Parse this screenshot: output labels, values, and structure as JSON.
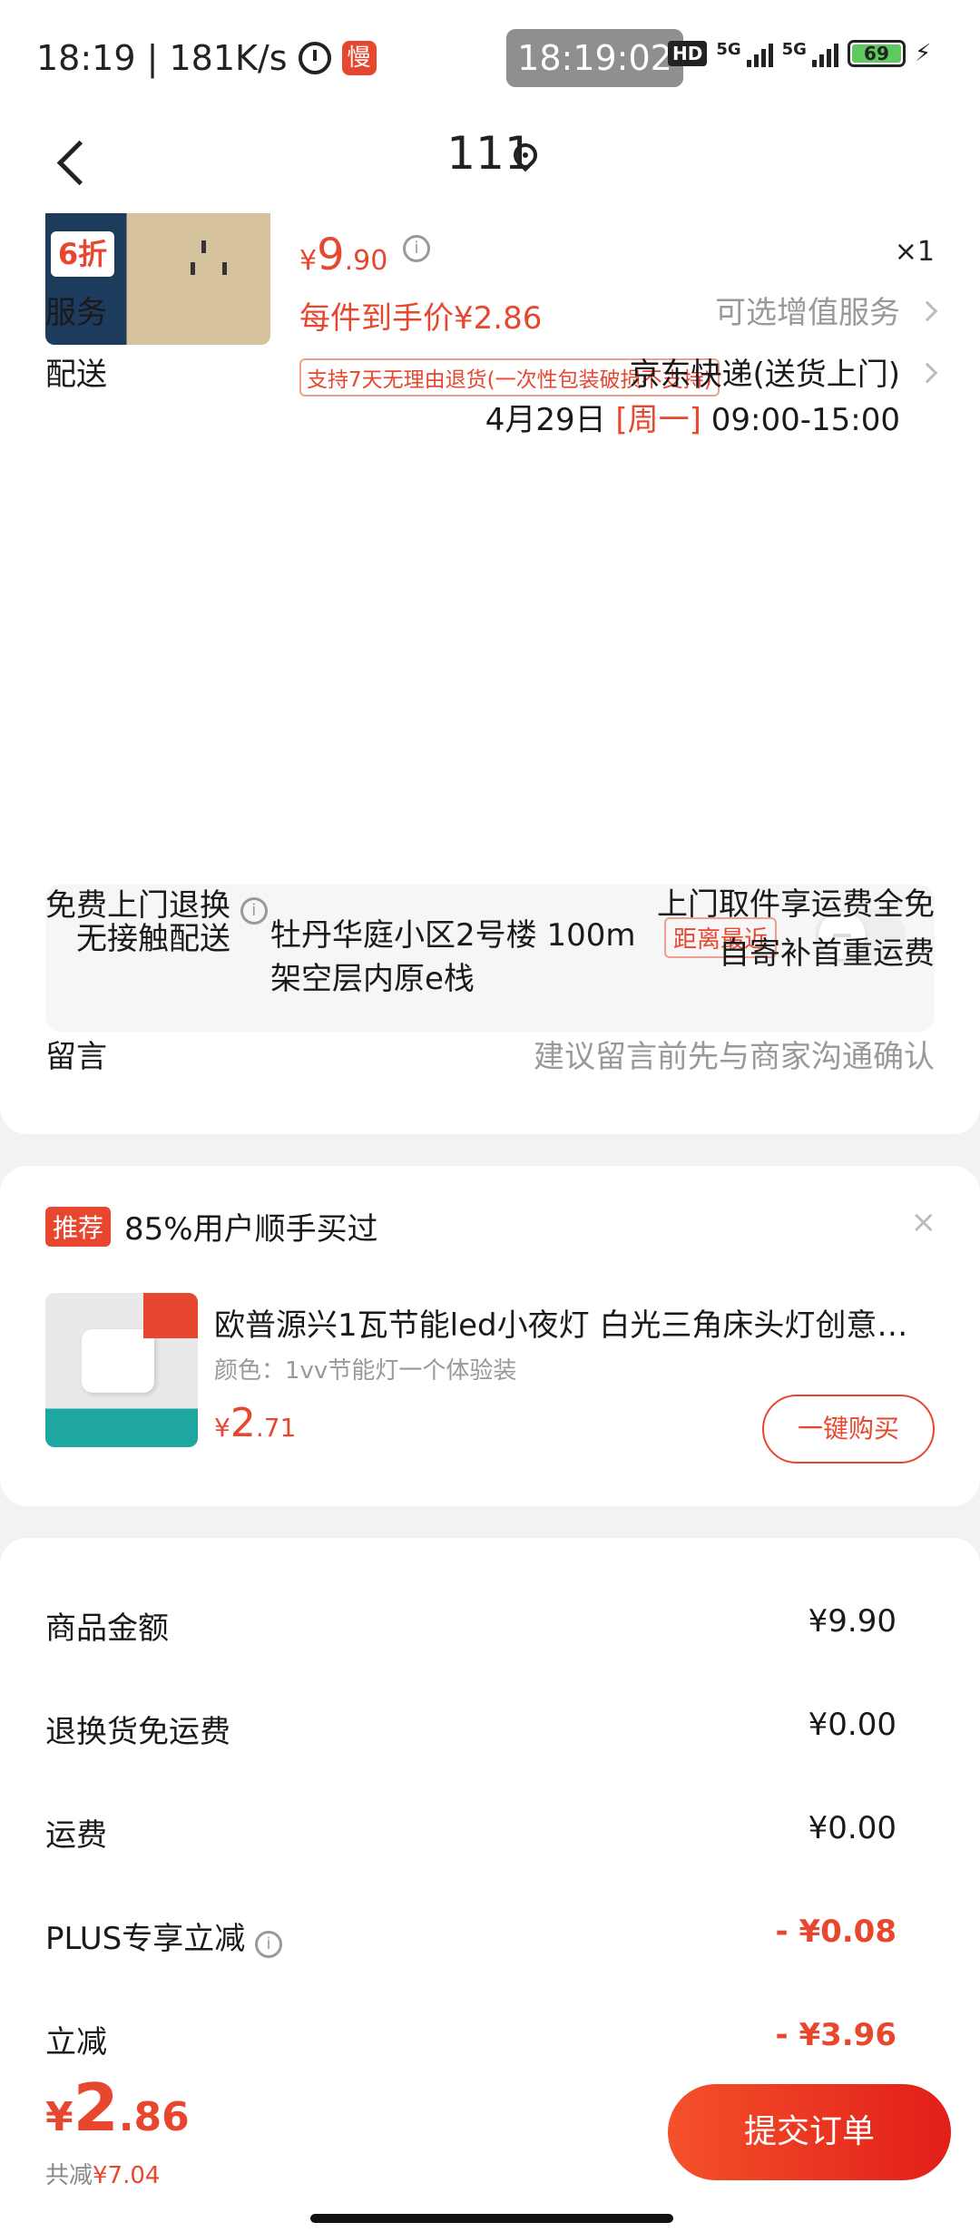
{
  "status_bar": {
    "time_speed": "18:19 | 181K/s",
    "app_badge": "慢",
    "clock": "18:19:02",
    "hd": "HD",
    "net1": "5G",
    "net2": "5G",
    "battery": "69"
  },
  "nav": {
    "title": "111"
  },
  "product": {
    "thumb_badge": "6折",
    "price_symbol": "¥",
    "price_int": "9",
    "price_dec": ".90",
    "quantity": "×1",
    "unit_price": "每件到手价¥2.86",
    "return_policy": "支持7天无理由退货(一次性包装破损不支持)"
  },
  "service": {
    "label": "服务",
    "value": "可选增值服务"
  },
  "delivery": {
    "label": "配送",
    "method": "京东快递(送货上门)",
    "date": "4月29日",
    "weekday": "[周一]",
    "time": "09:00-15:00"
  },
  "contactless": {
    "label": "无接触配送",
    "address_line1": "牡丹华庭小区2号楼 100m",
    "address_line2": "架空层内原e栈",
    "tag": "距离最近"
  },
  "free_return": {
    "label": "免费上门退换",
    "line1": "上门取件享运费全免",
    "line2": "自寄补首重运费"
  },
  "message": {
    "label": "留言",
    "placeholder": "建议留言前先与商家沟通确认"
  },
  "recommend": {
    "tag": "推荐",
    "title": "85%用户顺手买过",
    "close": "×",
    "product_name": "欧普源兴1瓦节能led小夜灯 白光三角床头灯创意插电式...",
    "variant": "颜色：1vv节能灯一个体验装",
    "price_symbol": "¥",
    "price_int": "2",
    "price_dec": ".71",
    "buy_label": "一键购买"
  },
  "summary": {
    "rows": [
      {
        "label": "商品金额",
        "value": "¥9.90"
      },
      {
        "label": "退换货免运费",
        "value": "¥0.00"
      },
      {
        "label": "运费",
        "value": "¥0.00"
      },
      {
        "label": "PLUS专享立减",
        "value": "- ¥0.08"
      },
      {
        "label": "立减",
        "value": "- ¥3.96"
      }
    ]
  },
  "footer": {
    "total_symbol": "¥",
    "total_int": "2",
    "total_dec": ".86",
    "saved_label": "共减",
    "saved_value": "¥7.04",
    "submit_label": "提交订单"
  },
  "colors": {
    "accent": "#e8472f",
    "muted": "#999999"
  }
}
